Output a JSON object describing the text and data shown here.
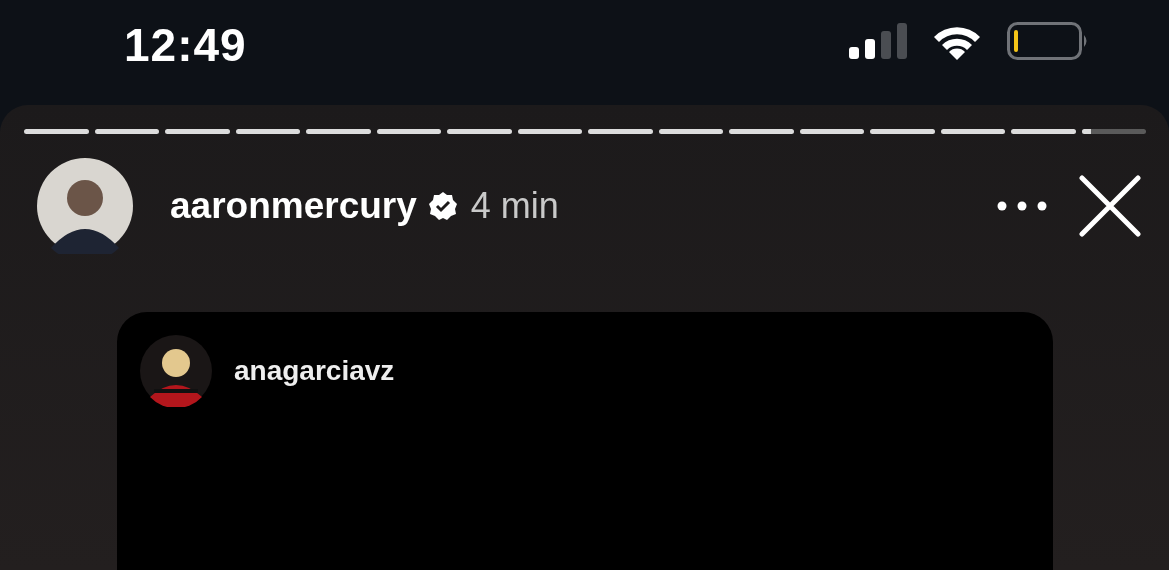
{
  "status_bar": {
    "time": "12:49"
  },
  "story": {
    "segments": [
      {
        "level": 1
      },
      {
        "level": 1
      },
      {
        "level": 1
      },
      {
        "level": 1
      },
      {
        "level": 1
      },
      {
        "level": 1
      },
      {
        "level": 1
      },
      {
        "level": 1
      },
      {
        "level": 1
      },
      {
        "level": 1
      },
      {
        "level": 1
      },
      {
        "level": 1
      },
      {
        "level": 1
      },
      {
        "level": 1
      },
      {
        "level": 1
      },
      {
        "level": 0.15
      }
    ],
    "username": "aaronmercury",
    "verified": true,
    "time_ago": "4 min",
    "shared_post": {
      "username": "anagarciavz"
    }
  }
}
